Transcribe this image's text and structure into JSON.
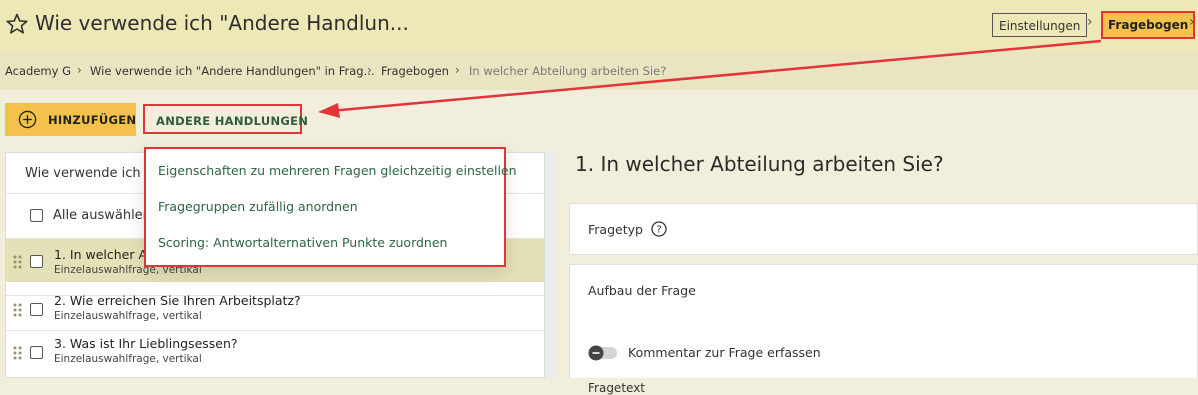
{
  "header": {
    "title": "Wie verwende ich \"Andere Handlun...",
    "settings_label": "Einstellungen",
    "questionnaire_label": "Fragebogen"
  },
  "breadcrumb": {
    "items": [
      "Academy G",
      "Wie verwende ich \"Andere Handlungen\" in Frag...",
      "Fragebogen",
      "In welcher Abteilung arbeiten Sie?"
    ]
  },
  "toolbar": {
    "add_label": "HINZUFÜGEN",
    "more_label": "ANDERE HANDLUNGEN"
  },
  "dropdown": {
    "items": [
      "Eigenschaften zu mehreren Fragen gleichzeitig einstellen",
      "Fragegruppen zufällig anordnen",
      "Scoring: Antwortalternativen Punkte zuordnen"
    ]
  },
  "left_panel": {
    "title": "Wie verwende ich \"A",
    "select_all": "Alle auswählen",
    "questions": [
      {
        "title": "1.  In welcher A",
        "type": "Einzelauswahlfrage, vertikal"
      },
      {
        "title": "2.  Wie erreichen Sie Ihren Arbeitsplatz?",
        "type": "Einzelauswahlfrage, vertikal"
      },
      {
        "title": "3.  Was ist Ihr Lieblingsessen?",
        "type": "Einzelauswahlfrage, vertikal"
      }
    ]
  },
  "main": {
    "question_heading": "1. In welcher Abteilung arbeiten Sie?",
    "question_type_label": "Fragetyp",
    "structure_label": "Aufbau der Frage",
    "comment_toggle_label": "Kommentar zur Frage erfassen",
    "question_text_label": "Fragetext"
  },
  "colors": {
    "accent_yellow": "#f4c14d",
    "highlight_red": "#e3343a",
    "link_green": "#2e6443",
    "header_bg": "#ede8b5"
  }
}
